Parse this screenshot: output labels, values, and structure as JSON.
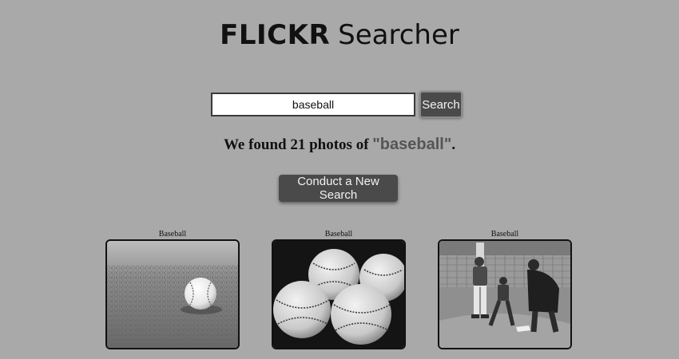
{
  "header": {
    "brand": "FLICKR",
    "title_rest": "Searcher"
  },
  "search": {
    "value": "baseball",
    "button_label": "Search"
  },
  "result": {
    "prefix": "We found 21 photos of ",
    "term": "\"baseball\"",
    "suffix": "."
  },
  "actions": {
    "new_search_label": "Conduct a New Search"
  },
  "photos": [
    {
      "caption": "Baseball",
      "subject": "baseball-on-grass"
    },
    {
      "caption": "Baseball",
      "subject": "four-baseballs"
    },
    {
      "caption": "Baseball",
      "subject": "youth-baseball-players"
    }
  ]
}
